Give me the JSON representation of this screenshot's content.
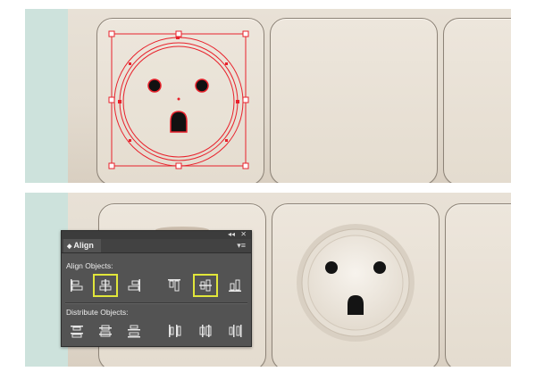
{
  "align_panel": {
    "collapse_glyph": "◂◂",
    "close_glyph": "✕",
    "tab_arrows": "◆",
    "tab_label": "Align",
    "menu_glyph": "▾≡",
    "align_objects_label": "Align Objects:",
    "distribute_objects_label": "Distribute Objects:",
    "align_buttons": [
      {
        "name": "horizontal-align-left",
        "icon": "align-left-icon",
        "highlighted": false
      },
      {
        "name": "horizontal-align-center",
        "icon": "align-horizontal-center-icon",
        "highlighted": true
      },
      {
        "name": "horizontal-align-right",
        "icon": "align-right-icon",
        "highlighted": false
      },
      {
        "name": "vertical-align-top",
        "icon": "align-top-icon",
        "highlighted": false
      },
      {
        "name": "vertical-align-center",
        "icon": "align-vertical-center-icon",
        "highlighted": true
      },
      {
        "name": "vertical-align-bottom",
        "icon": "align-bottom-icon",
        "highlighted": false
      }
    ],
    "distribute_buttons": [
      {
        "name": "vertical-distribute-top",
        "icon": "distribute-top-icon"
      },
      {
        "name": "vertical-distribute-center",
        "icon": "distribute-vertical-center-icon"
      },
      {
        "name": "vertical-distribute-bottom",
        "icon": "distribute-bottom-icon"
      },
      {
        "name": "horizontal-distribute-left",
        "icon": "distribute-left-icon"
      },
      {
        "name": "horizontal-distribute-center",
        "icon": "distribute-horizontal-center-icon"
      },
      {
        "name": "horizontal-distribute-right",
        "icon": "distribute-right-icon"
      }
    ]
  },
  "colors": {
    "selection": "#e8212b",
    "highlight": "#e1e63a",
    "panel_bg": "#535353",
    "teal_strip": "#cde2dc"
  }
}
